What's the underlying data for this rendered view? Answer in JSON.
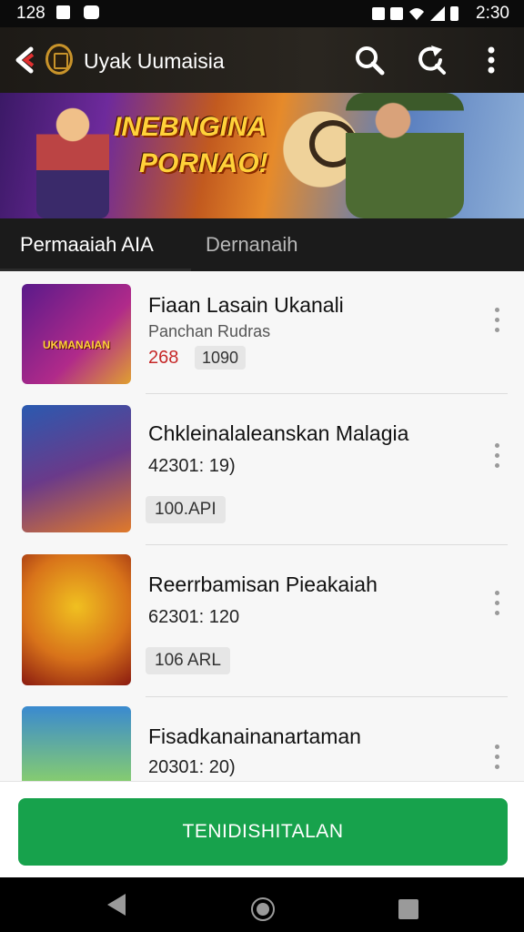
{
  "status_bar": {
    "time_left": "128",
    "time_right": "2:30"
  },
  "app_bar": {
    "title": "Uyak Uumaisia"
  },
  "banner": {
    "headline_line1": "INEBNGINA",
    "headline_line2": "PORNAO!"
  },
  "tabs": [
    {
      "label": "Permaaiah AIA"
    },
    {
      "label": "Dernanaih"
    }
  ],
  "games": [
    {
      "title": "Fiaan Lasain Ukanali",
      "subtitle": "Panchan Rudras",
      "price": "268",
      "chip": "1090",
      "thumb_text": "UKMANAIAN",
      "thumb_colors": [
        "#5a1a8a",
        "#b02a8a"
      ]
    },
    {
      "title": "Chkleinalaleanskan Malagia",
      "meta": "42301: 19)",
      "chip": "100.API",
      "thumb_colors": [
        "#2a5ab0",
        "#e07a2a"
      ]
    },
    {
      "title": "Reerrbamisan Pieakaiah",
      "meta": "62301: 120",
      "chip": "106 ARL",
      "thumb_colors": [
        "#d8731a",
        "#f0c020"
      ]
    },
    {
      "title": "Fisadkanainanartaman",
      "meta": "20301: 20)",
      "thumb_colors": [
        "#3a8ad0",
        "#8ad06a"
      ]
    }
  ],
  "install_button": {
    "label": "TENIDISHITALAN"
  },
  "colors": {
    "install_bg": "#17a24c",
    "price": "#c62828",
    "tab_bar": "#1b1b1b",
    "app_bar": "#211e1a"
  },
  "icons": [
    "back-arrow-icon",
    "app-logo-icon",
    "search-icon",
    "share-icon",
    "more-vert-icon",
    "nav-back-icon",
    "nav-home-icon",
    "nav-recent-icon"
  ]
}
